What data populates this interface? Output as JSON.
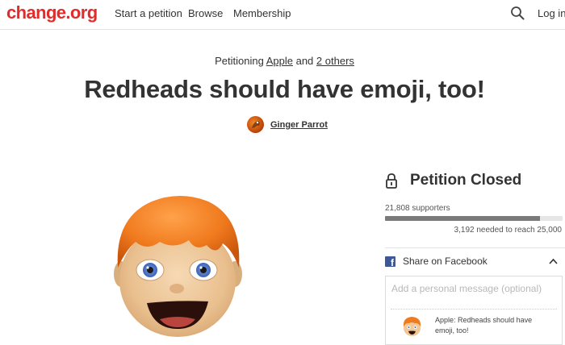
{
  "header": {
    "logo": "change.org",
    "nav": [
      "Start a petition",
      "Browse",
      "Membership"
    ],
    "login": "Log in",
    "search_icon": "search-icon"
  },
  "petition": {
    "targets_prefix": "Petitioning",
    "target_primary": "Apple",
    "targets_and": "and",
    "target_others": "2 others",
    "title": "Redheads should have emoji, too!",
    "author": "Ginger Parrot"
  },
  "status": {
    "closed_label": "Petition Closed",
    "supporters_text": "21,808 supporters",
    "supporters": 21808,
    "goal": 25000,
    "progress_fraction": 0.872,
    "needed_text": "3,192 needed to reach 25,000"
  },
  "share": {
    "facebook_label": "Share on Facebook",
    "message_placeholder": "Add a personal message (optional)",
    "preview_text": "Apple: Redheads should have emoji, too!"
  },
  "colors": {
    "brand": "#e12c2c",
    "facebook": "#3b5998",
    "progress": "#7a7a7a",
    "hair": "#f07a1e"
  }
}
